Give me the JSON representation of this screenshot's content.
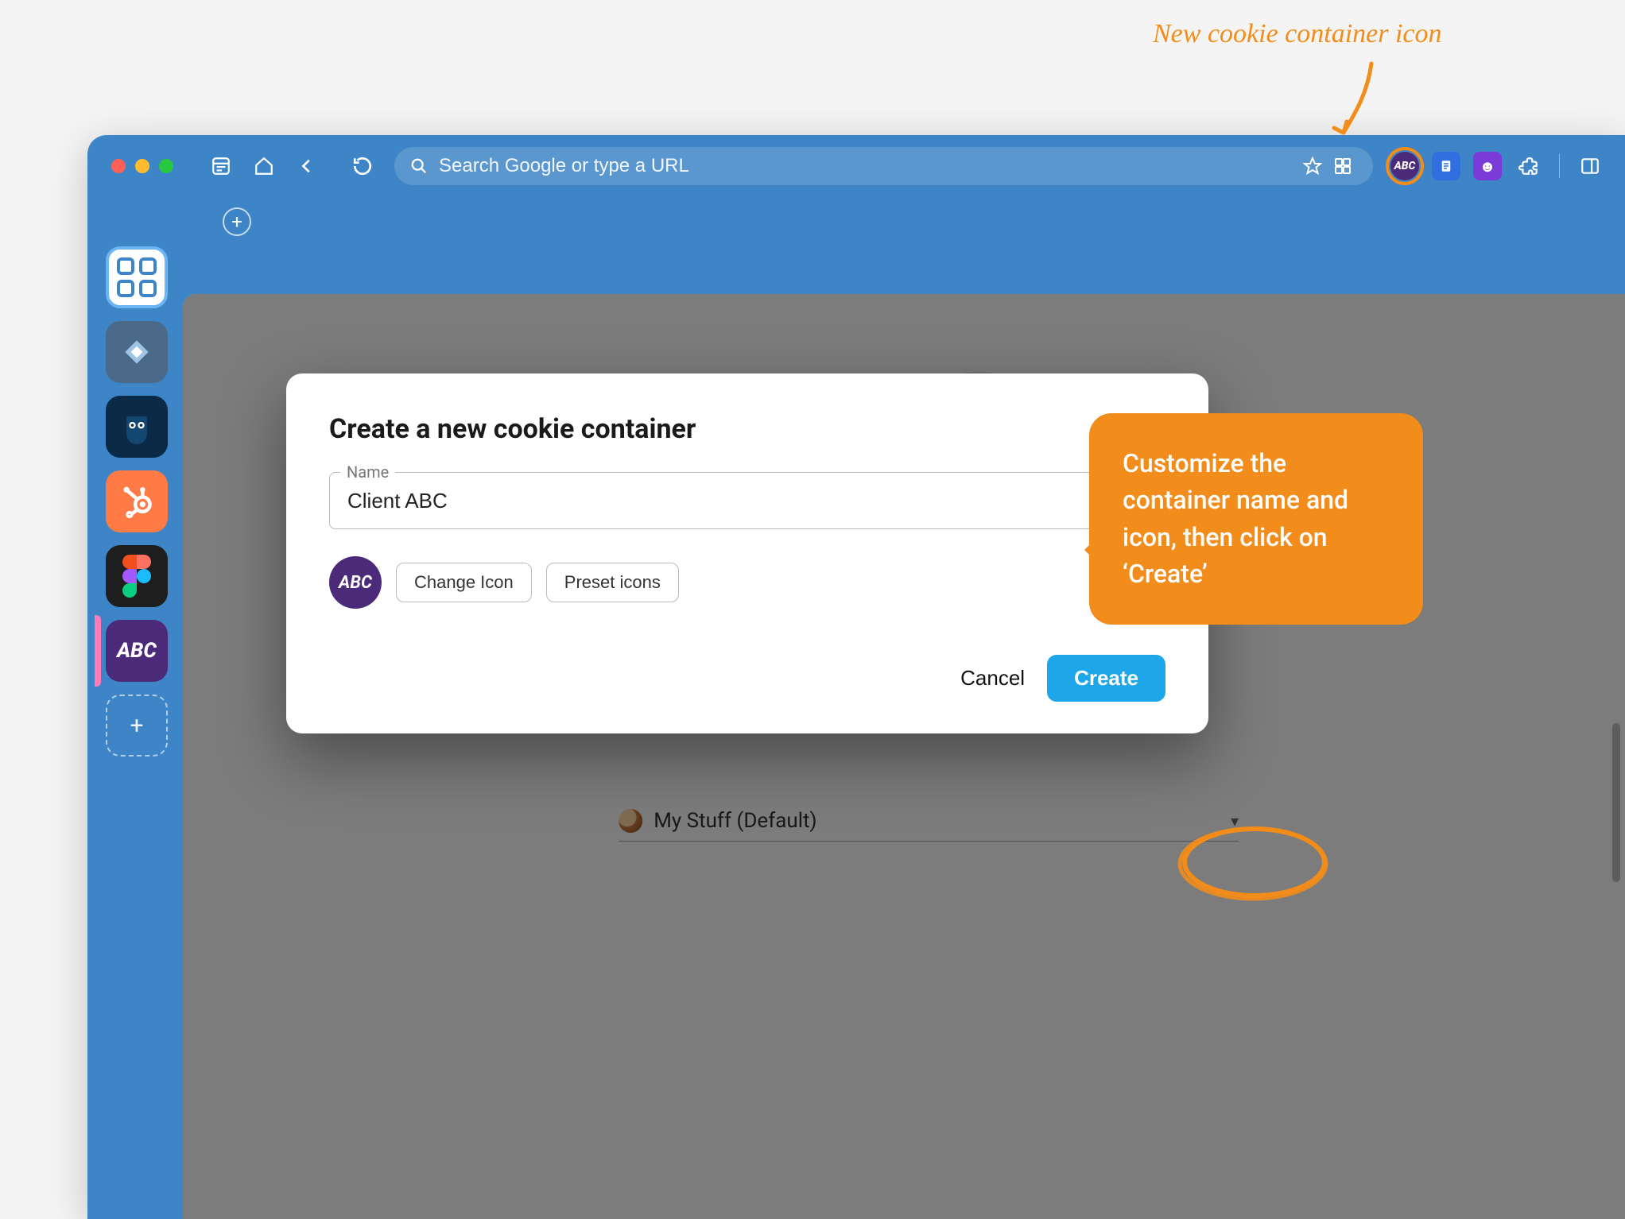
{
  "annotations": {
    "top_label": "New cookie container icon",
    "callout_text": "Customize the container name and icon, then click on ‘Create’"
  },
  "toolbar": {
    "url_placeholder": "Search Google or type a URL"
  },
  "sidebar": {
    "items": [
      {
        "name": "apps"
      },
      {
        "name": "clickup"
      },
      {
        "name": "hootsuite"
      },
      {
        "name": "hubspot"
      },
      {
        "name": "figma"
      },
      {
        "name": "client-abc",
        "label": "ABC"
      }
    ]
  },
  "extensions": {
    "cookie_container_label": "ABC"
  },
  "background": {
    "default_profile": "My Stuff (Default)"
  },
  "dialog": {
    "title": "Create a new cookie container",
    "name_label": "Name",
    "name_value": "Client ABC",
    "icon_preview_text": "ABC",
    "change_icon": "Change Icon",
    "preset_icons": "Preset icons",
    "cancel": "Cancel",
    "create": "Create"
  }
}
